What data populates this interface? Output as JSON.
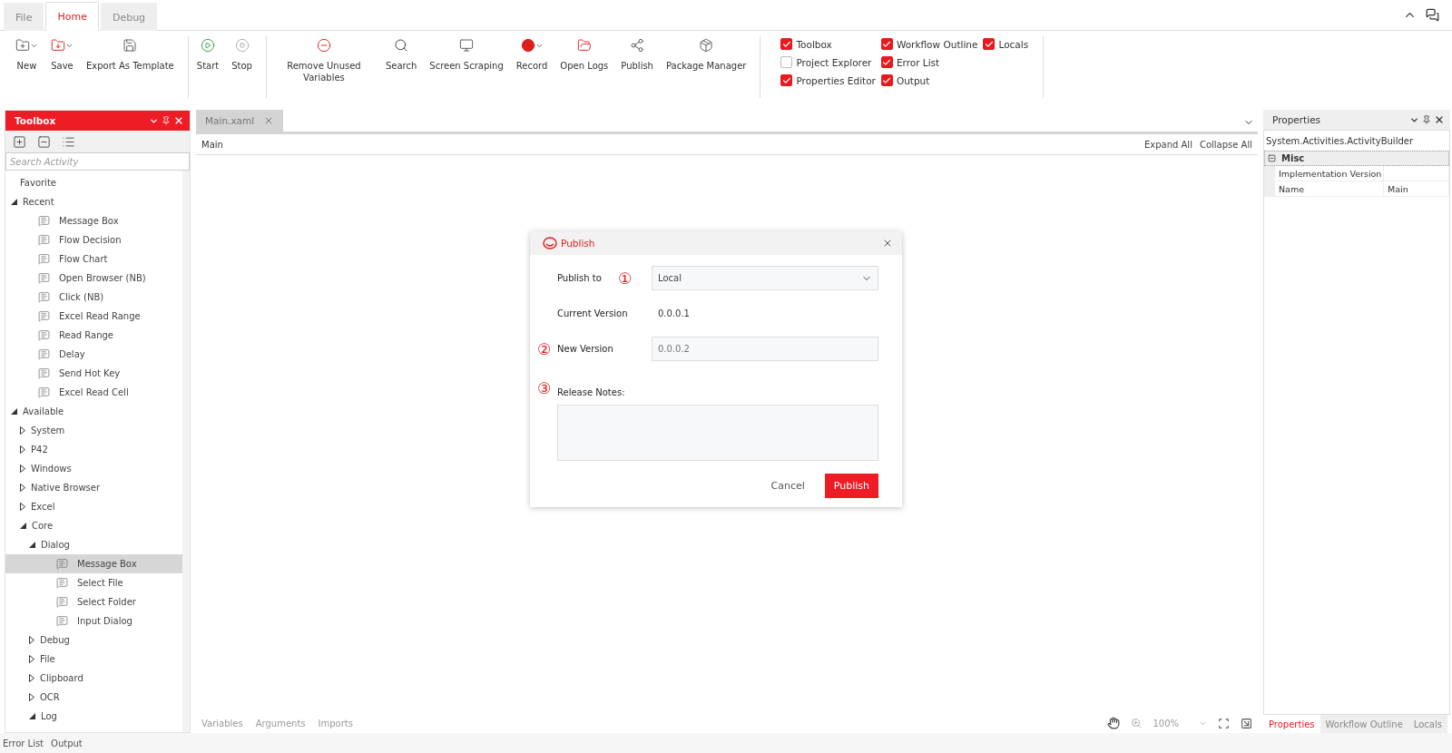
{
  "menu_tabs": [
    {
      "label": "File",
      "selected": false
    },
    {
      "label": "Home",
      "selected": true
    },
    {
      "label": "Debug",
      "selected": false
    }
  ],
  "ribbon": {
    "groups": [
      [
        {
          "label": "New",
          "dropdown": true
        },
        {
          "label": "Save",
          "dropdown": true
        },
        {
          "label": "Export As Template",
          "dropdown": false
        }
      ],
      [
        {
          "label": "Start",
          "dropdown": false
        },
        {
          "label": "Stop",
          "dropdown": false
        }
      ],
      [
        {
          "label": "Remove Unused Variables",
          "dropdown": false
        },
        {
          "label": "Search",
          "dropdown": false
        },
        {
          "label": "Screen Scraping",
          "dropdown": false
        },
        {
          "label": "Record",
          "dropdown": true
        },
        {
          "label": "Open Logs",
          "dropdown": false
        },
        {
          "label": "Publish",
          "dropdown": false
        },
        {
          "label": "Package Manager",
          "dropdown": false
        }
      ]
    ],
    "panels": [
      {
        "label": "Toolbox",
        "checked": true
      },
      {
        "label": "Workflow Outline",
        "checked": true
      },
      {
        "label": "Locals",
        "checked": true
      },
      {
        "label": "Project Explorer",
        "checked": false
      },
      {
        "label": "Error List",
        "checked": true
      },
      {
        "label": "Properties Editor",
        "checked": true
      },
      {
        "label": "Output",
        "checked": true
      }
    ]
  },
  "toolbox": {
    "title": "Toolbox",
    "search_placeholder": "Search Activity",
    "tree": [
      {
        "label": "Favorite",
        "kind": "plain"
      },
      {
        "label": "Recent",
        "kind": "group",
        "expanded": true,
        "children": [
          {
            "label": "Message Box",
            "kind": "activity",
            "selected": false
          },
          {
            "label": "Flow Decision",
            "kind": "activity",
            "selected": false
          },
          {
            "label": "Flow Chart",
            "kind": "activity",
            "selected": false
          },
          {
            "label": "Open Browser (NB)",
            "kind": "activity",
            "selected": false
          },
          {
            "label": "Click (NB)",
            "kind": "activity",
            "selected": false
          },
          {
            "label": "Excel Read Range",
            "kind": "activity",
            "selected": false
          },
          {
            "label": "Read Range",
            "kind": "activity",
            "selected": false
          },
          {
            "label": "Delay",
            "kind": "activity",
            "selected": false
          },
          {
            "label": "Send Hot Key",
            "kind": "activity",
            "selected": false
          },
          {
            "label": "Excel Read Cell",
            "kind": "activity",
            "selected": false
          }
        ]
      },
      {
        "label": "Available",
        "kind": "group",
        "expanded": true,
        "children": [
          {
            "label": "System",
            "kind": "group",
            "expanded": false
          },
          {
            "label": "P42",
            "kind": "group",
            "expanded": false
          },
          {
            "label": "Windows",
            "kind": "group",
            "expanded": false
          },
          {
            "label": "Native Browser",
            "kind": "group",
            "expanded": false
          },
          {
            "label": "Excel",
            "kind": "group",
            "expanded": false
          },
          {
            "label": "Core",
            "kind": "group",
            "expanded": true,
            "children": [
              {
                "label": "Dialog",
                "kind": "group",
                "expanded": true,
                "children": [
                  {
                    "label": "Message Box",
                    "kind": "activity",
                    "selected": true
                  },
                  {
                    "label": "Select File",
                    "kind": "activity",
                    "selected": false
                  },
                  {
                    "label": "Select Folder",
                    "kind": "activity",
                    "selected": false
                  },
                  {
                    "label": "Input Dialog",
                    "kind": "activity",
                    "selected": false
                  }
                ]
              },
              {
                "label": "Debug",
                "kind": "group",
                "expanded": false
              },
              {
                "label": "File",
                "kind": "group",
                "expanded": false
              },
              {
                "label": "Clipboard",
                "kind": "group",
                "expanded": false
              },
              {
                "label": "OCR",
                "kind": "group",
                "expanded": false
              },
              {
                "label": "Log",
                "kind": "group",
                "expanded": true
              }
            ]
          }
        ]
      }
    ]
  },
  "editor": {
    "tab": "Main.xaml",
    "breadcrumb": "Main",
    "expand_all": "Expand All",
    "collapse_all": "Collapse All",
    "bottom_tabs": [
      "Variables",
      "Arguments",
      "Imports"
    ],
    "zoom": "100%"
  },
  "dialog": {
    "title": "Publish",
    "publish_to_label": "Publish to",
    "marker_1": "①",
    "publish_to_value": "Local",
    "current_version_label": "Current Version",
    "current_version": "0.0.0.1",
    "marker_2": "②",
    "new_version_label": "New Version",
    "new_version_placeholder": "0.0.0.2",
    "marker_3": "③",
    "release_notes_label": "Release Notes:",
    "cancel": "Cancel",
    "publish": "Publish"
  },
  "properties": {
    "title": "Properties",
    "object": "System.Activities.ActivityBuilder",
    "category": "Misc",
    "rows": [
      {
        "name": "Implementation Version",
        "value": ""
      },
      {
        "name": "Name",
        "value": "Main"
      }
    ],
    "tabs": [
      {
        "label": "Properties",
        "selected": true
      },
      {
        "label": "Workflow Outline",
        "selected": false
      },
      {
        "label": "Locals",
        "selected": false
      }
    ]
  },
  "bottom_tabs": [
    "Error List",
    "Output"
  ]
}
